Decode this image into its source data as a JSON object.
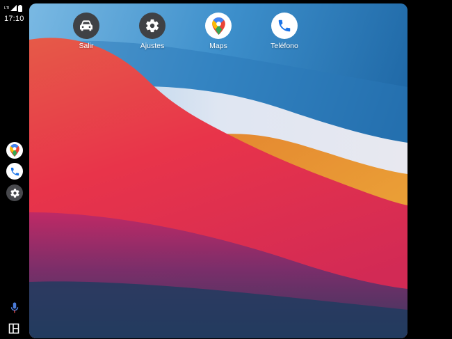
{
  "status_bar": {
    "time": "17:10",
    "icons": [
      "lte-icon",
      "signal-icon",
      "battery-icon"
    ]
  },
  "launcher": {
    "apps": [
      {
        "label": "Salir",
        "icon": "car-icon"
      },
      {
        "label": "Ajustes",
        "icon": "gear-icon"
      },
      {
        "label": "Maps",
        "icon": "maps-pin-icon"
      },
      {
        "label": "Teléfono",
        "icon": "phone-icon"
      }
    ]
  },
  "rail": {
    "apps": [
      {
        "icon": "maps-pin-icon"
      },
      {
        "icon": "phone-icon"
      },
      {
        "icon": "gear-icon"
      }
    ],
    "bottom": [
      {
        "icon": "microphone-icon"
      },
      {
        "icon": "split-layout-icon"
      }
    ]
  },
  "colors": {
    "wallpaper_sky": "#2c7fbf",
    "wallpaper_red": "#e63a47",
    "wallpaper_orange": "#e8a033",
    "wallpaper_deep": "#1d3c5f",
    "dark_icon_bg": "#3f4145",
    "phone_blue": "#1a73e8"
  }
}
